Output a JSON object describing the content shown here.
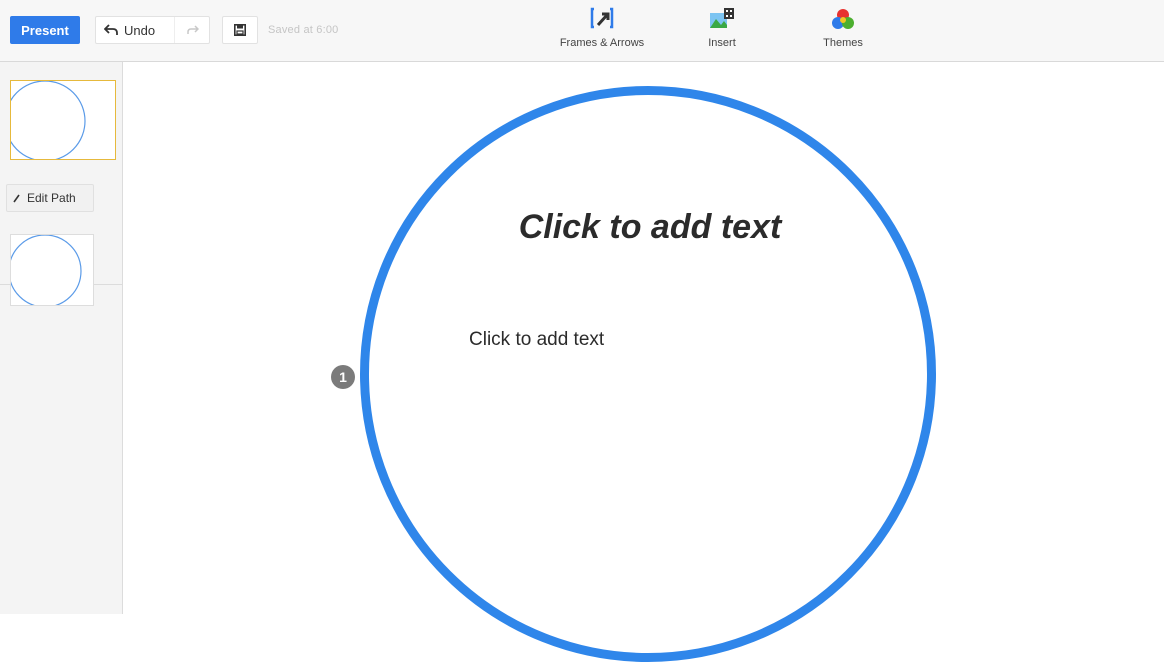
{
  "toolbar": {
    "present_label": "Present",
    "undo_label": "Undo",
    "saved_status": "Saved at 6:00",
    "tools": {
      "frames_label": "Frames & Arrows",
      "insert_label": "Insert",
      "themes_label": "Themes"
    }
  },
  "sidebar": {
    "edit_path_label": "Edit Path"
  },
  "canvas": {
    "frame_number": "1",
    "title_placeholder": "Click to add text",
    "body_placeholder": "Click to add text"
  },
  "icons": {
    "undo": "undo-arrow-icon",
    "redo": "redo-arrow-icon",
    "save": "floppy-disk-icon",
    "frames": "frames-arrows-icon",
    "insert": "insert-image-icon",
    "themes": "themes-palette-icon",
    "edit_path": "pencil-icon"
  },
  "colors": {
    "accent": "#2f7be9",
    "frame_stroke": "#2f86ea",
    "thumbnail_selected_border": "#e6b93c"
  }
}
